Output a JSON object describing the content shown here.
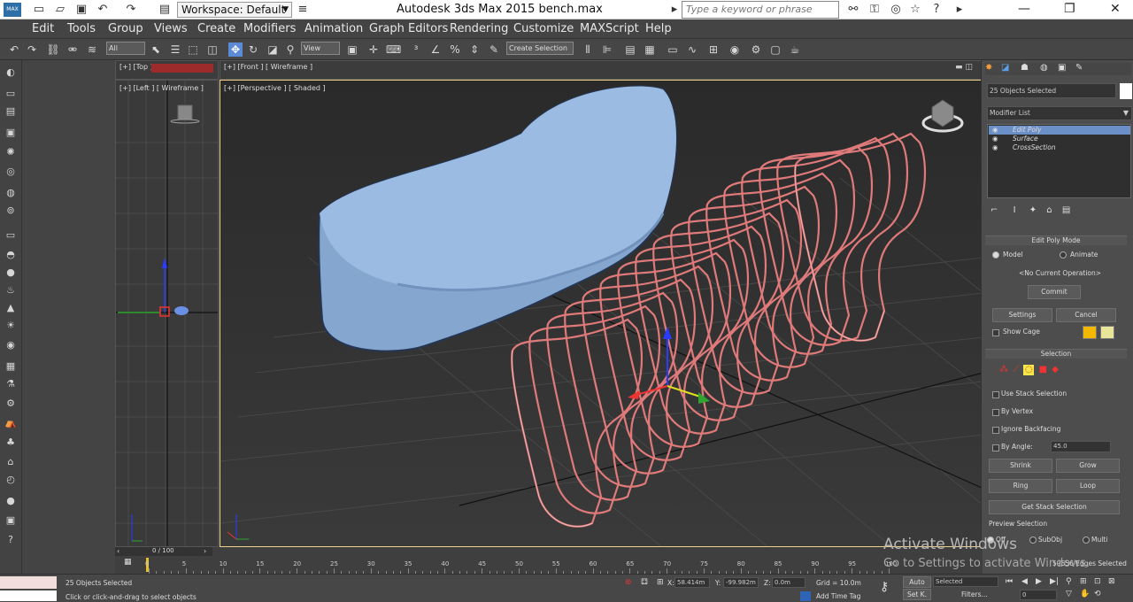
{
  "titlebar": {
    "workspace": "Workspace: Default",
    "app_title": "Autodesk 3ds Max  2015    bench.max",
    "search_placeholder": "Type a keyword or phrase",
    "max_logo": "MAX"
  },
  "menu": [
    "Edit",
    "Tools",
    "Group",
    "Views",
    "Create",
    "Modifiers",
    "Animation",
    "Graph Editors",
    "Rendering",
    "Customize",
    "MAXScript",
    "Help"
  ],
  "toolbar": {
    "selection_filter": "All",
    "ref_coord": "View",
    "named_selection": "Create Selection"
  },
  "viewports": {
    "top": "[+] [Top ] [ Wireframe ]",
    "front": "[+] [Front ] [ Wireframe ]",
    "left": "[+] [Left ] [ Wireframe ]",
    "perspective": "[+] [Perspective ] [ Shaded ]",
    "viewcube_left": "left"
  },
  "cmd_panel": {
    "selection_info": "25 Objects Selected",
    "modifier_list": "Modifier List",
    "stack": [
      "Edit Poly",
      "Surface",
      "CrossSection"
    ],
    "edit_poly_mode": "Edit Poly Mode",
    "model": "Model",
    "animate": "Animate",
    "no_op": "<No Current Operation>",
    "commit": "Commit",
    "settings": "Settings",
    "cancel": "Cancel",
    "show_cage": "Show Cage",
    "selection": "Selection",
    "use_stack": "Use Stack Selection",
    "by_vertex": "By Vertex",
    "ignore_backfacing": "Ignore Backfacing",
    "by_angle": "By Angle:",
    "angle_value": "45.0",
    "shrink": "Shrink",
    "grow": "Grow",
    "ring": "Ring",
    "loop": "Loop",
    "get_stack": "Get Stack Selection",
    "preview_selection": "Preview Selection",
    "off": "Off",
    "subobj": "SubObj",
    "multi": "Multi",
    "edges_selected": "59656 Edges Selected",
    "cage_colors": [
      "#f5b800",
      "#e8e49a"
    ]
  },
  "timeline": {
    "frame": "0 / 100",
    "ticks": [
      "0",
      "5",
      "10",
      "15",
      "20",
      "25",
      "30",
      "35",
      "40",
      "45",
      "50",
      "55",
      "60",
      "65",
      "70",
      "75",
      "80",
      "85",
      "90",
      "95",
      "100"
    ]
  },
  "status": {
    "objects_selected": "25 Objects Selected",
    "hint": "Click or click-and-drag to select objects",
    "x_label": "X:",
    "x_value": "58.414m",
    "y_label": "Y:",
    "y_value": "-99.982m",
    "z_label": "Z:",
    "z_value": "0.0m",
    "grid": "Grid = 10.0m",
    "add_time_tag": "Add Time Tag",
    "auto": "Auto",
    "set_key": "Set K.",
    "key_mode": "Selected",
    "filters": "Filters...",
    "frame_field": "0"
  },
  "watermark": {
    "line1": "Activate Windows",
    "line2": "Go to Settings to activate Windows."
  }
}
